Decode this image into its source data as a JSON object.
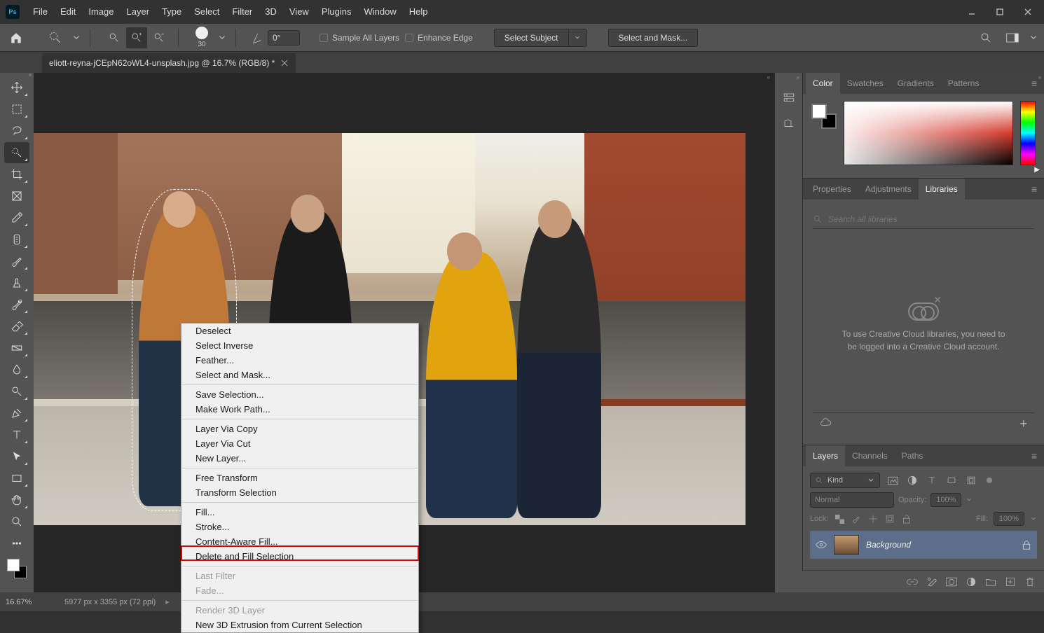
{
  "menubar": [
    "File",
    "Edit",
    "Image",
    "Layer",
    "Type",
    "Select",
    "Filter",
    "3D",
    "View",
    "Plugins",
    "Window",
    "Help"
  ],
  "optionsbar": {
    "brush_size": "30",
    "angle": "0°",
    "sample_all": "Sample All Layers",
    "enhance_edge": "Enhance Edge",
    "select_subject": "Select Subject",
    "select_and_mask": "Select and Mask..."
  },
  "doc_tab": "eliott-reyna-jCEpN62oWL4-unsplash.jpg @ 16.7% (RGB/8) *",
  "status": {
    "zoom": "16.67%",
    "dimensions": "5977 px x 3355 px (72 ppi)"
  },
  "context_menu": {
    "groups": [
      [
        "Deselect",
        "Select Inverse",
        "Feather...",
        "Select and Mask..."
      ],
      [
        "Save Selection...",
        "Make Work Path..."
      ],
      [
        "Layer Via Copy",
        "Layer Via Cut",
        "New Layer..."
      ],
      [
        "Free Transform",
        "Transform Selection"
      ],
      [
        "Fill...",
        "Stroke...",
        "Content-Aware Fill...",
        "Delete and Fill Selection"
      ],
      [
        "Last Filter",
        "Fade..."
      ],
      [
        "Render 3D Layer",
        "New 3D Extrusion from Current Selection"
      ]
    ],
    "disabled": [
      "Last Filter",
      "Fade...",
      "Render 3D Layer"
    ],
    "highlighted": "Content-Aware Fill..."
  },
  "right": {
    "color_tabs": [
      "Color",
      "Swatches",
      "Gradients",
      "Patterns"
    ],
    "color_active": "Color",
    "prop_tabs": [
      "Properties",
      "Adjustments",
      "Libraries"
    ],
    "prop_active": "Libraries",
    "lib_search_placeholder": "Search all libraries",
    "lib_msg": "To use Creative Cloud libraries, you need to be logged into a Creative Cloud account.",
    "layer_tabs": [
      "Layers",
      "Channels",
      "Paths"
    ],
    "layer_active": "Layers",
    "kind_label": "Kind",
    "blend_mode": "Normal",
    "opacity_label": "Opacity:",
    "opacity_value": "100%",
    "lock_label": "Lock:",
    "fill_label": "Fill:",
    "fill_value": "100%",
    "bg_layer": "Background"
  }
}
